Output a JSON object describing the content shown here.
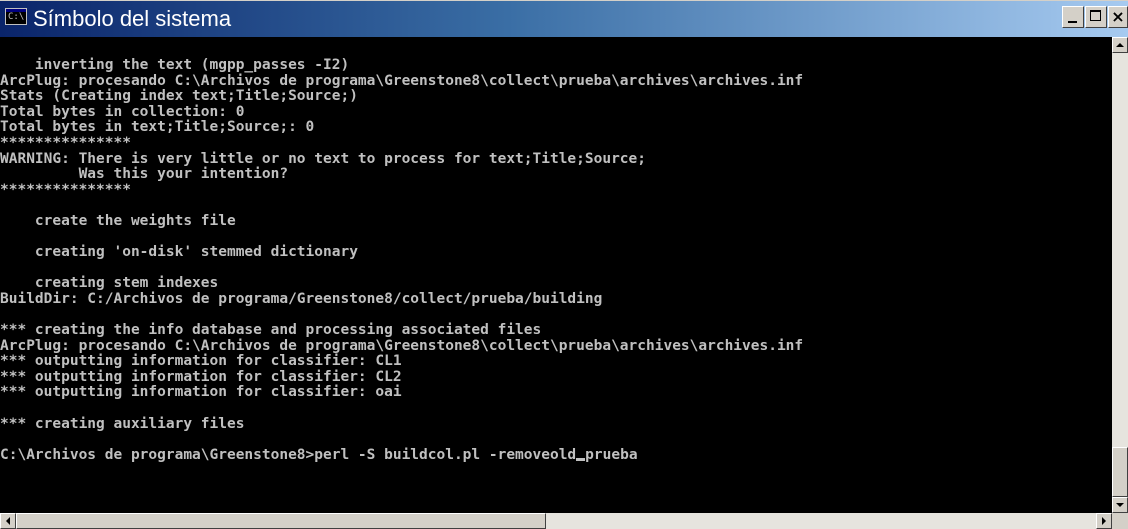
{
  "window": {
    "title": "Símbolo del sistema",
    "icon": "console-icon",
    "icon_text": "C:\\",
    "close_glyph": "×"
  },
  "console": {
    "lines": [
      "    inverting the text (mgpp_passes -I2)",
      "ArcPlug: procesando C:\\Archivos de programa\\Greenstone8\\collect\\prueba\\archives\\archives.inf",
      "Stats (Creating index text;Title;Source;)",
      "Total bytes in collection: 0",
      "Total bytes in text;Title;Source;: 0",
      "***************",
      "WARNING: There is very little or no text to process for text;Title;Source;",
      "         Was this your intention?",
      "***************",
      "",
      "    create the weights file",
      "",
      "    creating 'on-disk' stemmed dictionary",
      "",
      "    creating stem indexes",
      "BuildDir: C:/Archivos de programa/Greenstone8/collect/prueba/building",
      "",
      "*** creating the info database and processing associated files",
      "ArcPlug: procesando C:\\Archivos de programa\\Greenstone8\\collect\\prueba\\archives\\archives.inf",
      "*** outputting information for classifier: CL1",
      "*** outputting information for classifier: CL2",
      "*** outputting information for classifier: oai",
      "",
      "*** creating auxiliary files",
      ""
    ],
    "prompt_before_cursor": "C:\\Archivos de programa\\Greenstone8>perl -S buildcol.pl -removeold",
    "prompt_after_cursor": "prueba"
  },
  "colors": {
    "console_bg": "#000000",
    "console_fg": "#c0c0c0",
    "titlebar_start": "#0a246a",
    "titlebar_end": "#a6caf0"
  }
}
